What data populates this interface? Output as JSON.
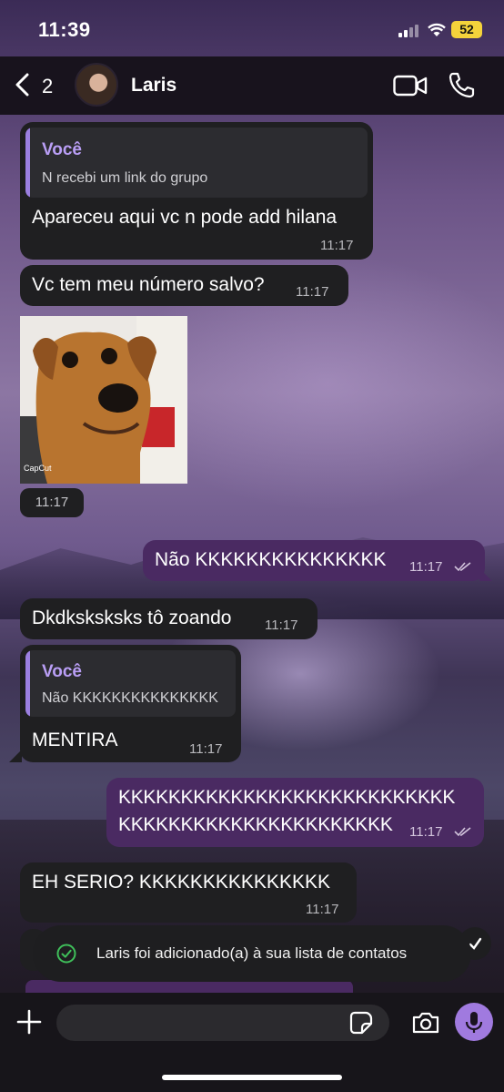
{
  "status_bar": {
    "time": "11:39",
    "battery": "52"
  },
  "header": {
    "back_count": "2",
    "contact_name": "Laris"
  },
  "messages": [
    {
      "quote_name": "Você",
      "quote_text": "N recebi um link do grupo",
      "text": "Apareceu aqui vc n pode add hilana",
      "time": "11:17"
    },
    {
      "text": "Vc tem meu número salvo?",
      "time": "11:17"
    },
    {
      "photo_watermark": "CapCut",
      "time": "11:17"
    },
    {
      "text": "Não KKKKKKKKKKKKKKK",
      "time": "11:17"
    },
    {
      "text": "Dkdksksksks tô zoando",
      "time": "11:17"
    },
    {
      "quote_name": "Você",
      "quote_text": "Não KKKKKKKKKKKKKKK",
      "text": "MENTIRA",
      "time": "11:17"
    },
    {
      "line1": "KKKKKKKKKKKKKKKKKKKKKKKKKKK",
      "line2": "KKKKKKKKKKKKKKKKKKKKKK",
      "time": "11:17"
    },
    {
      "text": "EH SERIO? KKKKKKKKKKKKKKK",
      "time": "11:17"
    }
  ],
  "toast": {
    "text": "Laris foi adicionado(a) à sua lista de contatos"
  },
  "composer": {
    "placeholder": ""
  },
  "colors": {
    "accent": "#a07adf",
    "outgoing": "#4a2a62",
    "incoming": "#1f1f21",
    "quote_name": "#b99ef5"
  }
}
